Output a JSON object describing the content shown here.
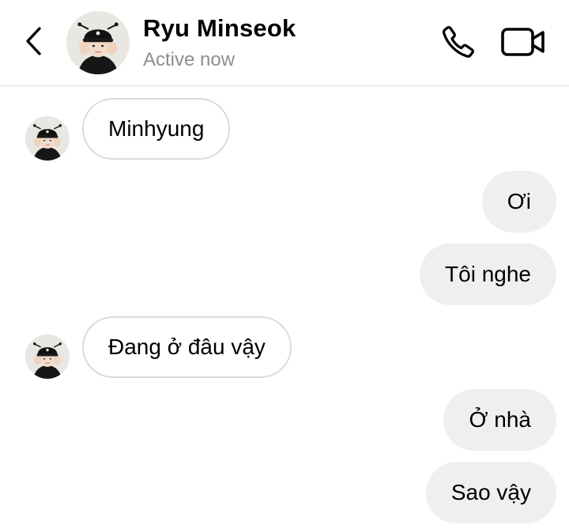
{
  "header": {
    "contact_name": "Ryu Minseok",
    "status": "Active now",
    "icons": {
      "back": "chevron-left-icon",
      "call": "phone-icon",
      "video": "video-camera-icon"
    }
  },
  "messages": [
    {
      "direction": "incoming",
      "text": "Minhyung",
      "show_avatar": true
    },
    {
      "direction": "outgoing",
      "text": "Ơi"
    },
    {
      "direction": "outgoing",
      "text": "Tôi nghe"
    },
    {
      "direction": "incoming",
      "text": "Đang ở đâu vậy",
      "show_avatar": true
    },
    {
      "direction": "outgoing",
      "text": "Ở nhà"
    },
    {
      "direction": "outgoing",
      "text": "Sao vậy"
    }
  ],
  "colors": {
    "incoming_border": "#dbdbdb",
    "outgoing_bg": "#efefef",
    "status_text": "#8e8e8e"
  }
}
